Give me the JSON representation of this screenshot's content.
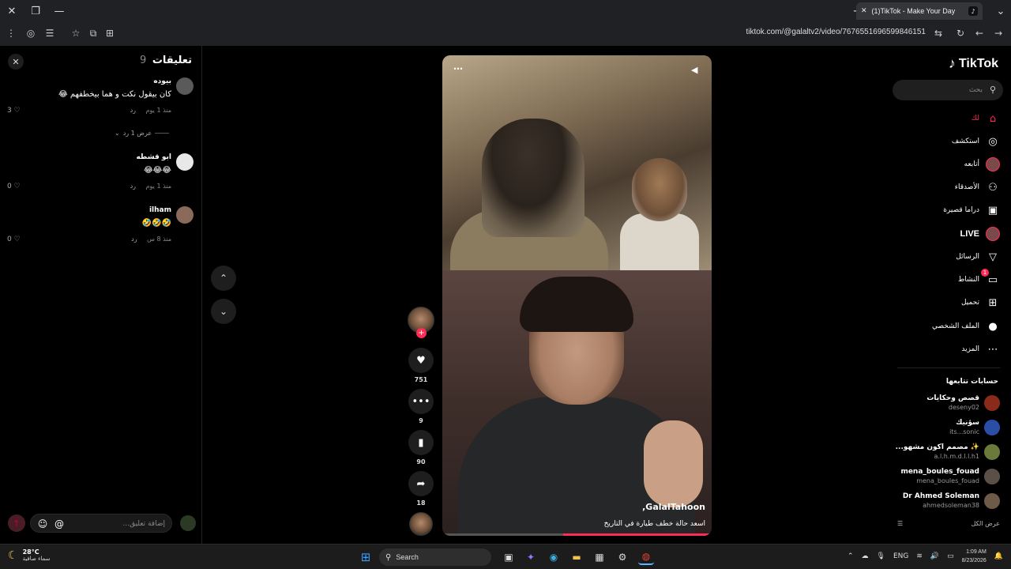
{
  "browser": {
    "tab_title": "(1)TikTok - Make Your Day",
    "url": "tiktok.com/@galaltv2/video/7676551696599846151"
  },
  "comments": {
    "title": "تعليقات",
    "count": "9",
    "items": [
      {
        "name": "بيوده",
        "text": "كان بيقول نكت و هما بيخطفهم 😂",
        "time": "منذ 1 يوم",
        "reply": "رد",
        "likes": "3"
      },
      {
        "name": "ابو قشطه",
        "text": "😂😂😂",
        "time": "منذ 1 يوم",
        "reply": "رد",
        "likes": "0"
      },
      {
        "name": "ilham",
        "text": "🤣🤣🤣",
        "time": "منذ 8 س",
        "reply": "رد",
        "likes": "0"
      }
    ],
    "view_replies": "عرض 1 رد",
    "input_placeholder": "إضافة تعليق...",
    "at_symbol": "@"
  },
  "video": {
    "author": "GalalTahoon,",
    "description": "اسعد حالة خطف طيارة في التاريخ",
    "progress": 0.55
  },
  "actions": {
    "likes": "751",
    "comments": "9",
    "saves": "90",
    "shares": "18"
  },
  "sidebar": {
    "logo_text": "TikTok",
    "search_placeholder": "بحث",
    "nav": [
      {
        "label": "لك",
        "icon": "home-icon",
        "glyph": "⌂"
      },
      {
        "label": "استكشف",
        "icon": "compass-icon",
        "glyph": "◎"
      },
      {
        "label": "أتابعه",
        "icon": "avatar-icon",
        "glyph": ""
      },
      {
        "label": "الأصدقاء",
        "icon": "friends-icon",
        "glyph": "⚇"
      },
      {
        "label": "دراما قصيرة",
        "icon": "film-icon",
        "glyph": "▣"
      },
      {
        "label": "LIVE",
        "icon": "live-icon",
        "glyph": ""
      },
      {
        "label": "الرسائل",
        "icon": "send-icon",
        "glyph": "▽"
      },
      {
        "label": "النشاط",
        "icon": "activity-icon",
        "glyph": "▭",
        "badge": "1"
      },
      {
        "label": "تحميل",
        "icon": "upload-icon",
        "glyph": "⊞"
      },
      {
        "label": "الملف الشخصي",
        "icon": "profile-icon",
        "glyph": "●"
      },
      {
        "label": "المزيد",
        "icon": "more-icon",
        "glyph": "⋯"
      }
    ],
    "following_title": "حسابات تتابعها",
    "following": [
      {
        "name": "قصص وحكايات",
        "handle": "deseny02",
        "color": "#8a2a1a"
      },
      {
        "name": "سؤنيك",
        "handle": "its...sonic",
        "color": "#2a4ea8"
      },
      {
        "name": "✨ مصمم اكون مشهو...",
        "handle": "a.l.h.m.d.l.l.h1",
        "color": "#6b7a3a"
      },
      {
        "name": "mena_boules_fouad",
        "handle": "mena_boules_fouad",
        "color": "#5a5048"
      },
      {
        "name": "Dr Ahmed Soleman",
        "handle": "ahmedsoleman38",
        "color": "#6d5a48"
      }
    ],
    "see_all": "عرض الكل"
  },
  "taskbar": {
    "temp": "28°C",
    "weather_desc": "سماء صافية",
    "search_label": "Search",
    "lang": "ENG",
    "time": "1:09 AM",
    "date": "8/23/2026"
  }
}
